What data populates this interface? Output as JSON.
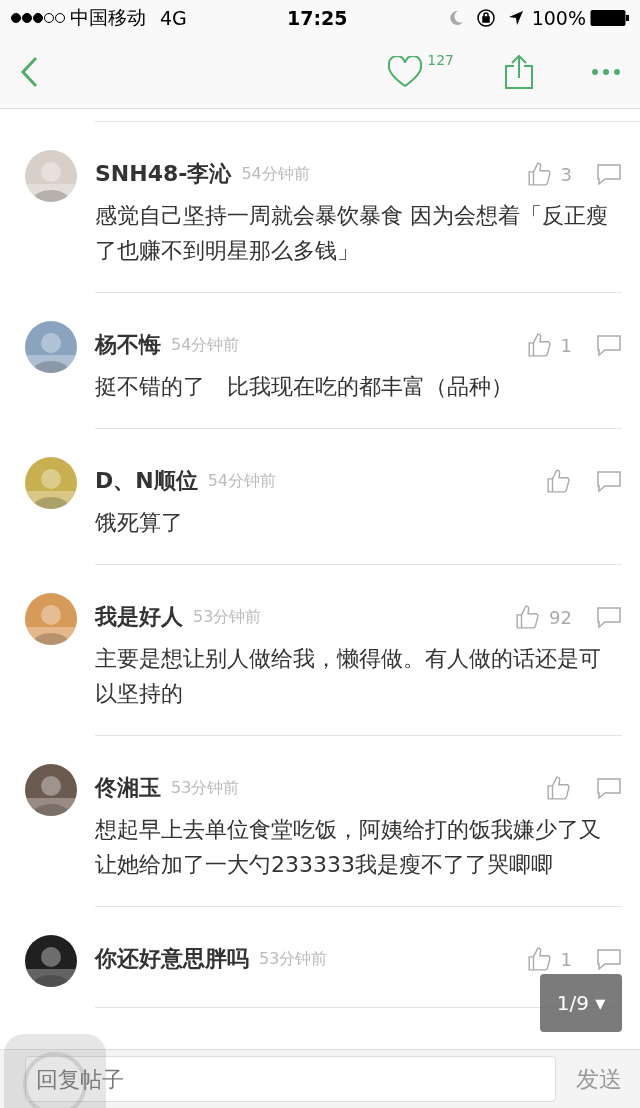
{
  "status_bar": {
    "carrier": "中国移动",
    "network": "4G",
    "time": "17:25",
    "battery": "100%"
  },
  "nav": {
    "likes": "127"
  },
  "comments": [
    {
      "name": "SNH48-李沁",
      "time": "54分钟前",
      "likes": "3",
      "text": "感觉自己坚持一周就会暴饮暴食 因为会想着「反正瘦了也赚不到明星那么多钱」"
    },
    {
      "name": "杨不悔",
      "time": "54分钟前",
      "likes": "1",
      "text": "挺不错的了　比我现在吃的都丰富（品种）"
    },
    {
      "name": "D、N顺位",
      "time": "54分钟前",
      "text": "饿死算了"
    },
    {
      "name": "我是好人",
      "time": "53分钟前",
      "likes": "92",
      "text": "主要是想让别人做给我，懒得做。有人做的话还是可以坚持的"
    },
    {
      "name": "佟湘玉",
      "time": "53分钟前",
      "text": "想起早上去单位食堂吃饭，阿姨给打的饭我嫌少了又让她给加了一大勺233333我是瘦不了了哭唧唧"
    },
    {
      "name": "你还好意思胖吗",
      "time": "53分钟前",
      "likes": "1"
    }
  ],
  "page_indicator": "1/9 ▾",
  "reply_bar": {
    "placeholder": "回复帖子",
    "send": "发送"
  }
}
